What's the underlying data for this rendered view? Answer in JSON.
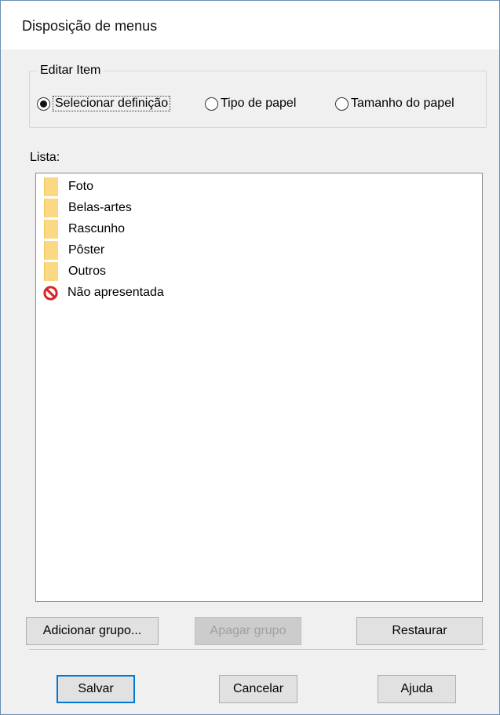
{
  "window": {
    "title": "Disposição de menus"
  },
  "edit_group": {
    "legend": "Editar Item",
    "options": [
      {
        "label": "Selecionar definição",
        "checked": true
      },
      {
        "label": "Tipo de papel",
        "checked": false
      },
      {
        "label": "Tamanho do papel",
        "checked": false
      }
    ]
  },
  "list": {
    "label": "Lista:",
    "items": [
      {
        "label": "Foto",
        "icon": "folder-icon"
      },
      {
        "label": "Belas-artes",
        "icon": "folder-icon"
      },
      {
        "label": "Rascunho",
        "icon": "folder-icon"
      },
      {
        "label": "Pôster",
        "icon": "folder-icon"
      },
      {
        "label": "Outros",
        "icon": "folder-icon"
      },
      {
        "label": "Não apresentada",
        "icon": "no-entry-icon"
      }
    ]
  },
  "actions": {
    "add_group": "Adicionar grupo...",
    "delete_group": "Apagar grupo",
    "restore": "Restaurar"
  },
  "footer": {
    "save": "Salvar",
    "cancel": "Cancelar",
    "help": "Ajuda"
  },
  "colors": {
    "accent": "#0078d7",
    "folder": "#fbd984",
    "no_entry": "#d9262c"
  }
}
